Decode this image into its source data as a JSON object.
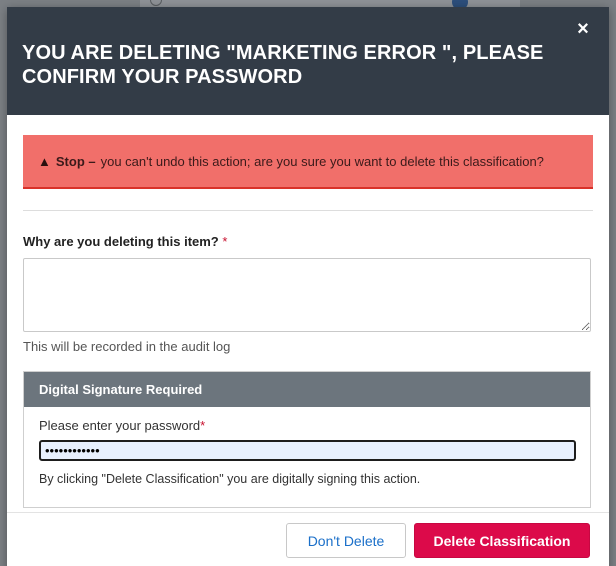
{
  "dialog": {
    "title": "YOU ARE DELETING \"MARKETING ERROR \", PLEASE CONFIRM YOUR PASSWORD",
    "close_icon": "×"
  },
  "alert": {
    "icon": "warning-triangle-icon",
    "icon_glyph": "▲",
    "strong": "Stop –",
    "message": "you can't undo this action; are you sure you want to delete this classification?",
    "bg_color": "#f16f6a"
  },
  "reason": {
    "label": "Why are you deleting this item?",
    "required_mark": "*",
    "value": "",
    "helper": "This will be recorded in the audit log"
  },
  "signature": {
    "header": "Digital Signature Required",
    "password_label": "Please enter your password",
    "required_mark": "*",
    "password_value": "••••••••••••",
    "note": "By clicking \"Delete Classification\" you are digitally signing this action."
  },
  "footer": {
    "cancel_label": "Don't Delete",
    "delete_label": "Delete Classification",
    "delete_color": "#dc0a4a"
  }
}
